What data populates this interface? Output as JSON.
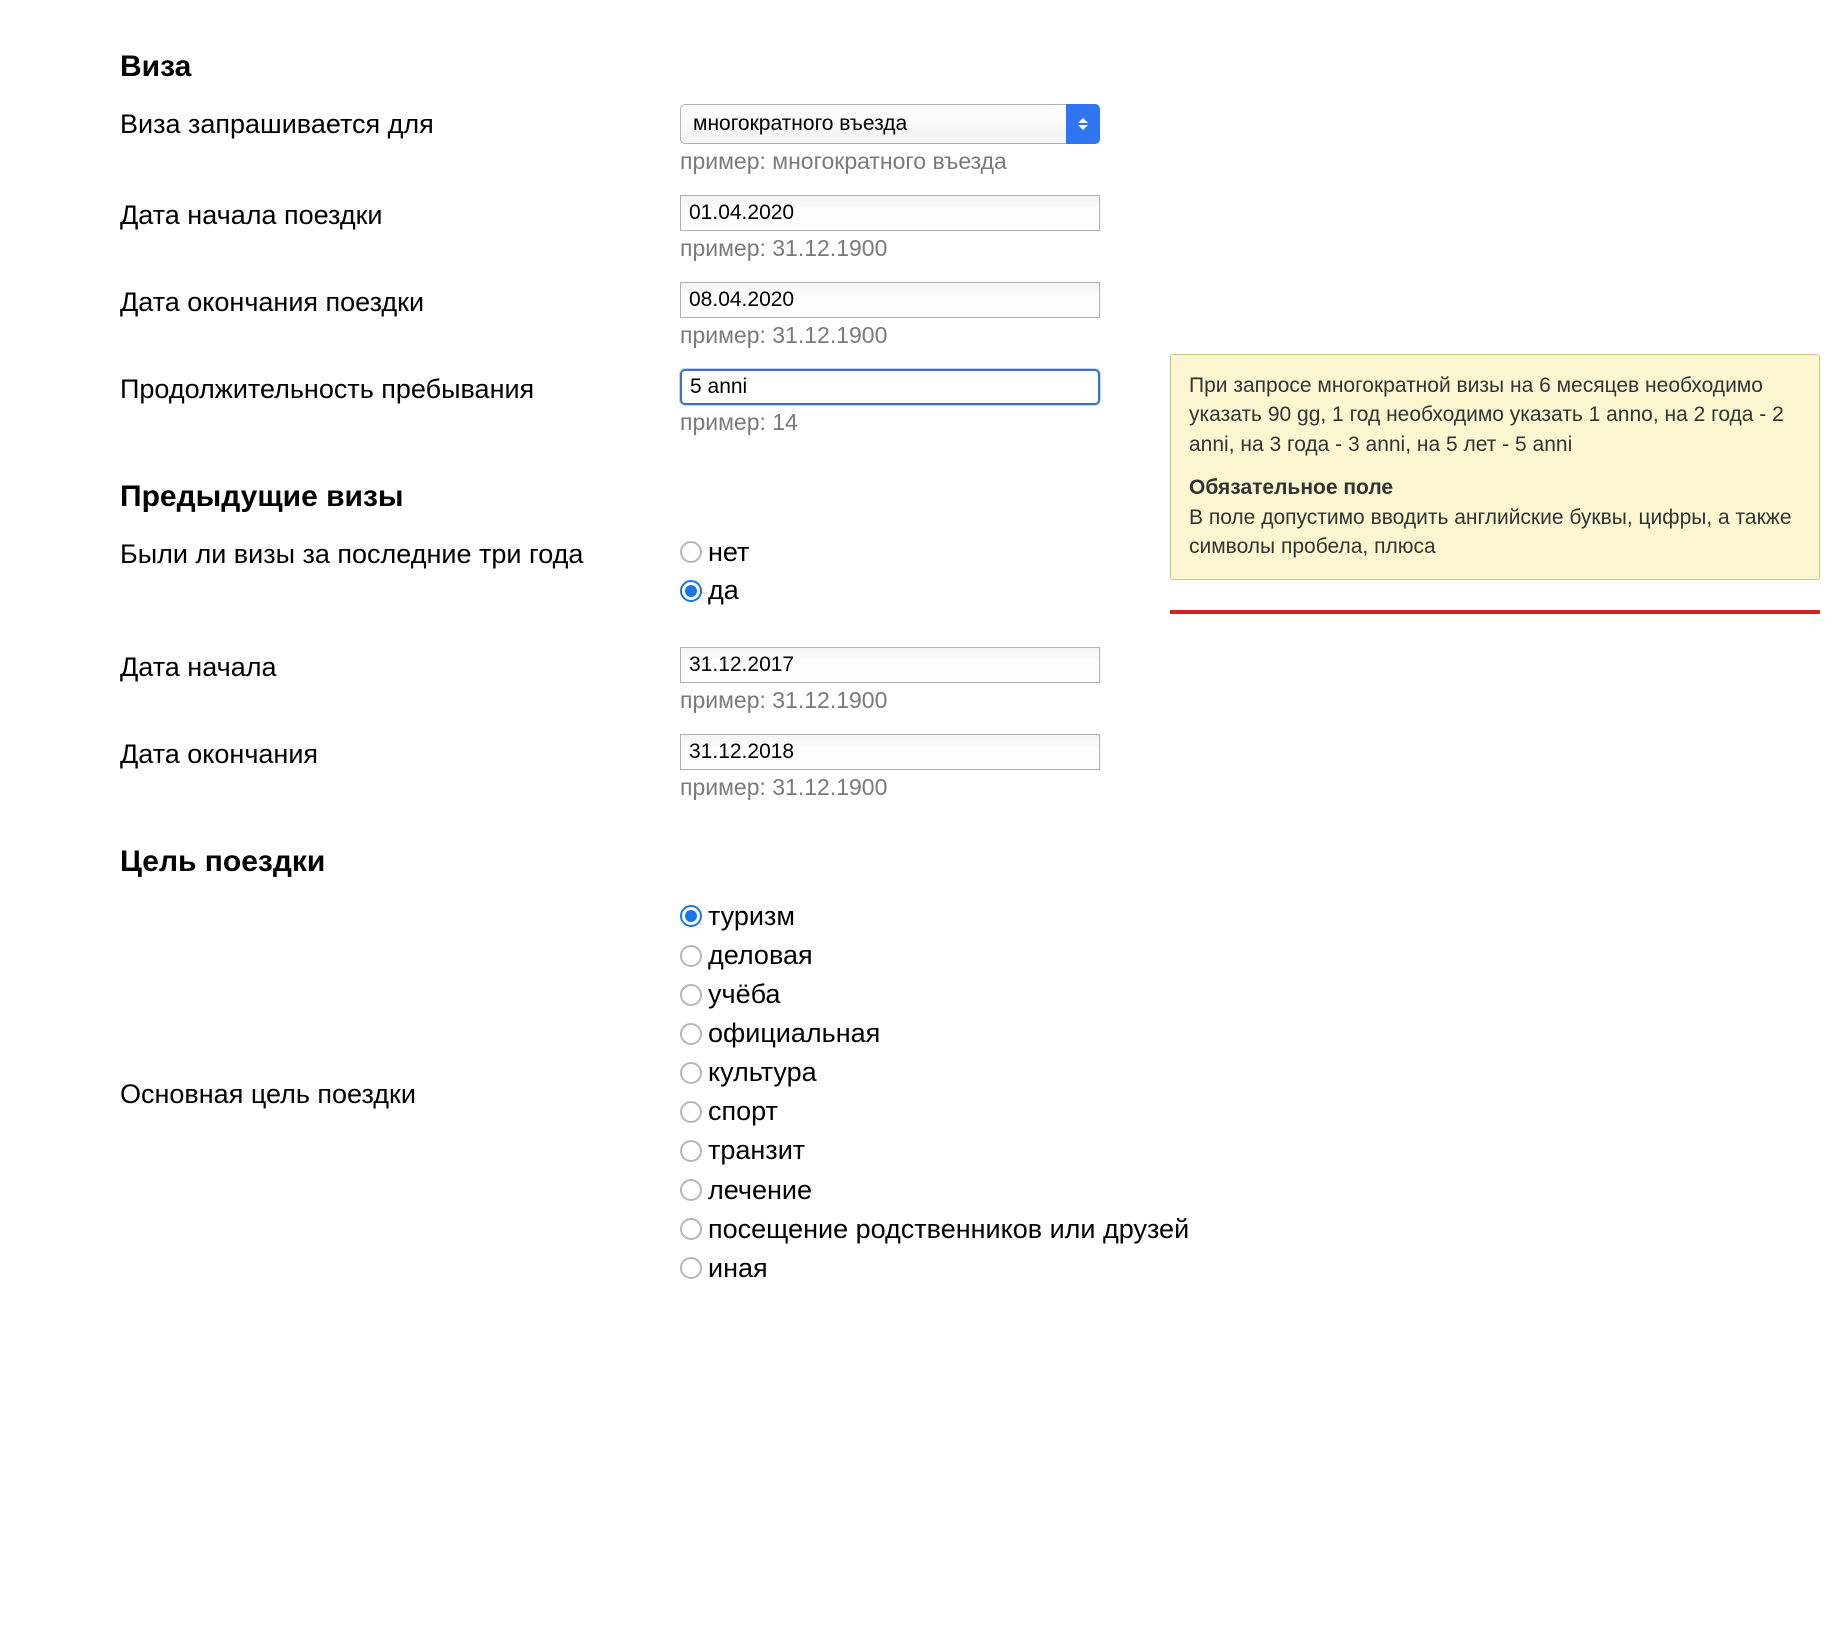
{
  "sections": {
    "visa": "Виза",
    "previous": "Предыдущие визы",
    "purpose": "Цель поездки"
  },
  "visa": {
    "requested_for_label": "Виза запрашивается для",
    "requested_for_value": "многократного въезда",
    "requested_for_hint": "пример: многократного въезда",
    "trip_start_label": "Дата начала поездки",
    "trip_start_value": "01.04.2020",
    "trip_start_hint": "пример: 31.12.1900",
    "trip_end_label": "Дата окончания поездки",
    "trip_end_value": "08.04.2020",
    "trip_end_hint": "пример: 31.12.1900",
    "duration_label": "Продолжительность пребывания",
    "duration_value": "5 anni",
    "duration_hint": "пример: 14"
  },
  "previous": {
    "had_visas_label": "Были ли визы за последние три года",
    "no_label": "нет",
    "yes_label": "да",
    "start_label": "Дата начала",
    "start_value": "31.12.2017",
    "start_hint": "пример: 31.12.1900",
    "end_label": "Дата окончания",
    "end_value": "31.12.2018",
    "end_hint": "пример: 31.12.1900"
  },
  "purpose": {
    "main_label": "Основная цель поездки",
    "options": [
      "туризм",
      "деловая",
      "учёба",
      "официальная",
      "культура",
      "спорт",
      "транзит",
      "лечение",
      "посещение родственников или друзей",
      "иная"
    ],
    "selected_index": 0
  },
  "tooltip": {
    "p1": "При запросе многократной визы на 6 месяцев необходимо указать 90 gg, 1 год необходимо указать 1 anno, на 2 года - 2 anni, на 3 года - 3 anni, на 5 лет - 5 anni",
    "strong": "Обязательное поле",
    "p2": "В поле допустимо вводить английские буквы, цифры, а также символы пробела, плюса"
  }
}
